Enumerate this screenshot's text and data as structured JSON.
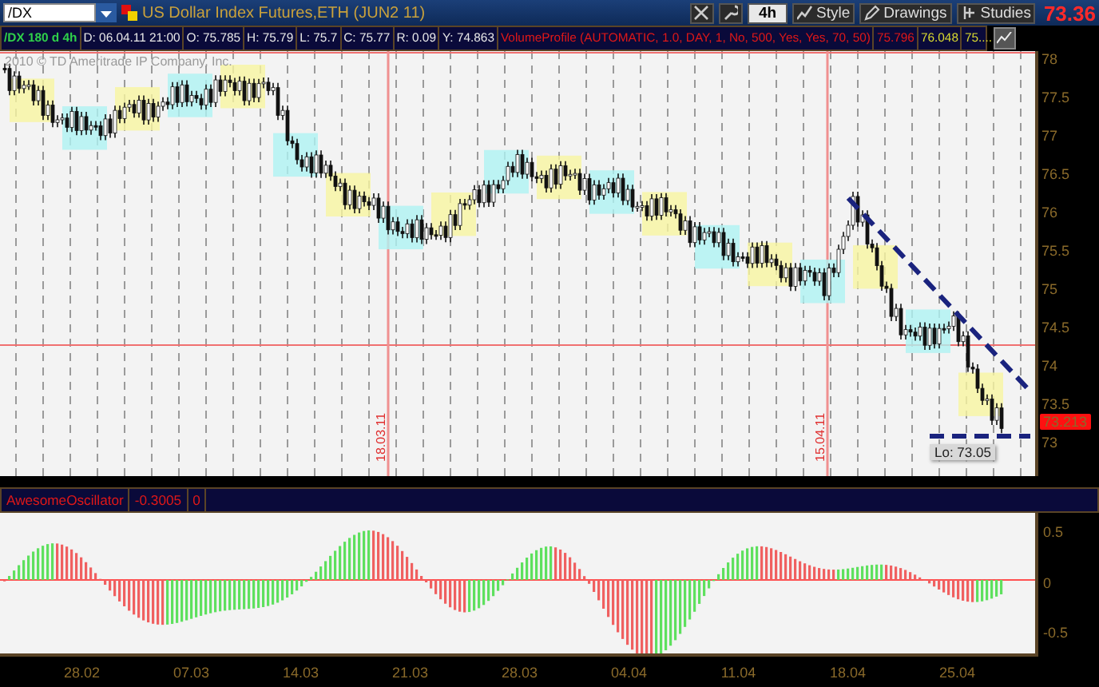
{
  "symbol_field": {
    "value": "/DX"
  },
  "instrument_title": "US Dollar Index Futures,ETH (JUN2 11)",
  "toolbar": {
    "period": "4h",
    "buttons": [
      {
        "kind": "style",
        "label": "Style"
      },
      {
        "kind": "drawings",
        "label": "Drawings"
      },
      {
        "kind": "studies",
        "label": "Studies"
      }
    ]
  },
  "last_price": "73.36",
  "info_bar": [
    {
      "kind": "symbol",
      "text": "/DX 180 d 4h"
    },
    {
      "kind": "value",
      "text": "D: 06.04.11 21:00"
    },
    {
      "kind": "value",
      "text": "O: 75.785"
    },
    {
      "kind": "value",
      "text": "H: 75.79"
    },
    {
      "kind": "value",
      "text": "L: 75.7"
    },
    {
      "kind": "value",
      "text": "C: 75.77"
    },
    {
      "kind": "value",
      "text": "R: 0.09"
    },
    {
      "kind": "value",
      "text": "Y: 74.863"
    },
    {
      "kind": "study",
      "text": "VolumeProfile (AUTOMATIC, 1.0, DAY, 1, No, 500, Yes, Yes, 70, 50)"
    },
    {
      "kind": "study",
      "text": "75.796"
    },
    {
      "kind": "level",
      "text": "76.048"
    },
    {
      "kind": "level",
      "text": "75...."
    }
  ],
  "price_chart": {
    "copyright": "2010 © TD Ameritrade IP Company, Inc.",
    "price_axis": [
      "78",
      "77.5",
      "77",
      "76.5",
      "76",
      "75.5",
      "75",
      "74.5",
      "74",
      "73.5",
      "73"
    ],
    "current_price_tag": "73.213",
    "date_markers": [
      "18.03.11",
      "15.04.11"
    ],
    "low_label": "Lo: 73.05"
  },
  "oscillator": {
    "name": "AwesomeOscillator",
    "value": "-0.3005",
    "second_value": "0",
    "axis": [
      "0.5",
      "0",
      "-0.5"
    ]
  },
  "date_axis": [
    "28.02",
    "07.03",
    "14.03",
    "21.03",
    "28.03",
    "04.04",
    "11.04",
    "18.04",
    "25.04"
  ]
}
